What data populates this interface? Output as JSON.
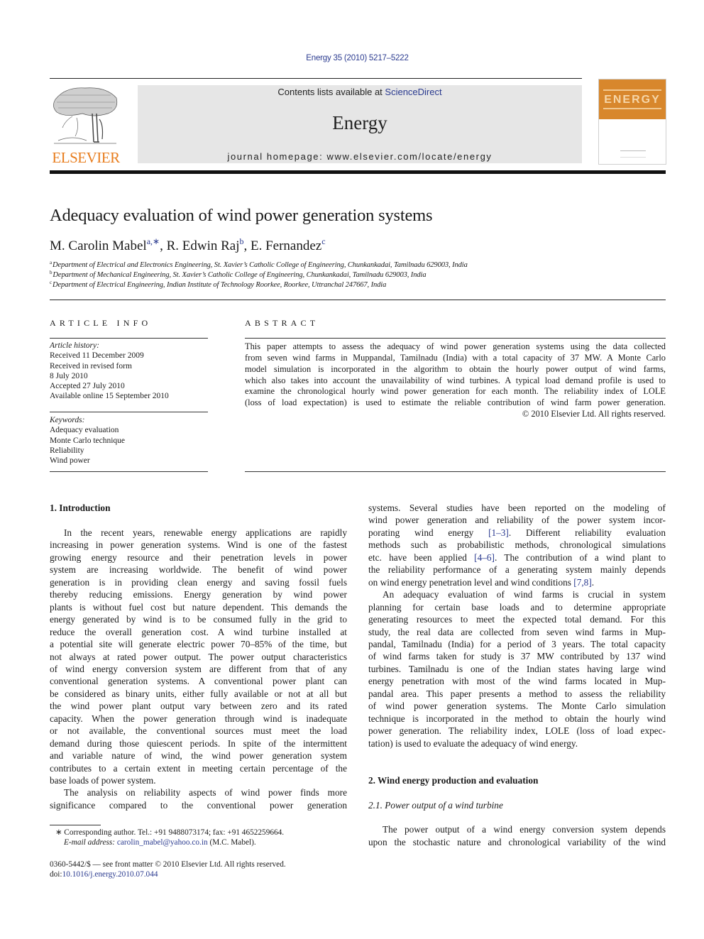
{
  "citation": "Energy 35 (2010) 5217–5222",
  "header": {
    "publisher_logo_text": "ELSEVIER",
    "contents_prefix": "Contents lists available at ",
    "contents_link": "ScienceDirect",
    "journal_name": "Energy",
    "homepage": "journal homepage: www.elsevier.com/locate/energy",
    "cover_title": "ENERGY",
    "accent_color": "#e87d1e",
    "cover_color": "#d8872c"
  },
  "title": "Adequacy evaluation of wind power generation systems",
  "authors": [
    {
      "name": "M. Carolin Mabel",
      "sup": "a,∗",
      "sep": ", "
    },
    {
      "name": "R. Edwin Raj",
      "sup": "b",
      "sep": ", "
    },
    {
      "name": "E. Fernandez",
      "sup": "c",
      "sep": ""
    }
  ],
  "affiliations": [
    {
      "mark": "a",
      "text": "Department of Electrical and Electronics Engineering, St. Xavier’s Catholic College of Engineering, Chunkankadai, Tamilnadu 629003, India"
    },
    {
      "mark": "b",
      "text": "Department of Mechanical Engineering, St. Xavier’s Catholic College of Engineering, Chunkankadai, Tamilnadu 629003, India"
    },
    {
      "mark": "c",
      "text": "Department of Electrical Engineering, Indian Institute of Technology Roorkee, Roorkee, Uttranchal 247667, India"
    }
  ],
  "article_info": {
    "heading": "ARTICLE INFO",
    "history_label": "Article history:",
    "history": [
      "Received 11 December 2009",
      "Received in revised form",
      "8 July 2010",
      "Accepted 27 July 2010",
      "Available online 15 September 2010"
    ],
    "keywords_label": "Keywords:",
    "keywords": [
      "Adequacy evaluation",
      "Monte Carlo technique",
      "Reliability",
      "Wind power"
    ]
  },
  "abstract": {
    "heading": "ABSTRACT",
    "lines": [
      "This paper attempts to assess the adequacy of wind power generation systems using the data collected",
      "from seven wind farms in Muppandal, Tamilnadu (India) with a total capacity of 37 MW. A Monte Carlo",
      "model simulation is incorporated in the algorithm to obtain the hourly power output of wind farms,",
      "which also takes into account the unavailability of wind turbines. A typical load demand profile is used to",
      "examine the chronological hourly wind power generation for each month. The reliability index of LOLE",
      "(loss of load expectation) is used to estimate the reliable contribution of wind farm power generation."
    ],
    "copyright": "© 2010 Elsevier Ltd. All rights reserved."
  },
  "body": {
    "section1_heading": "1.  Introduction",
    "left_col": [
      {
        "t": "In the recent years, renewable energy applications are rapidly",
        "i": true
      },
      {
        "t": "increasing in power generation systems. Wind is one of the fastest"
      },
      {
        "t": "growing energy resource and their penetration levels in power"
      },
      {
        "t": "system are increasing worldwide. The benefit of wind power"
      },
      {
        "t": "generation is in providing clean energy and saving fossil fuels"
      },
      {
        "t": "thereby reducing emissions. Energy generation by wind power"
      },
      {
        "t": "plants is without fuel cost but nature dependent. This demands the"
      },
      {
        "t": "energy generated by wind is to be consumed fully in the grid to"
      },
      {
        "t": "reduce the overall generation cost. A wind turbine installed at"
      },
      {
        "t": "a potential site will generate electric power 70–85% of the time, but"
      },
      {
        "t": "not always at rated power output. The power output characteristics"
      },
      {
        "t": "of wind energy conversion system are different from that of any"
      },
      {
        "t": "conventional generation systems. A conventional power plant can"
      },
      {
        "t": "be considered as binary units, either fully available or not at all but"
      },
      {
        "t": "the wind power plant output vary between zero and its rated"
      },
      {
        "t": "capacity. When the power generation through wind is inadequate"
      },
      {
        "t": "or not available, the conventional sources must meet the load"
      },
      {
        "t": "demand during those quiescent periods. In spite of the intermittent"
      },
      {
        "t": "and variable nature of wind, the wind power generation system"
      },
      {
        "t": "contributes to a certain extent in meeting certain percentage of the"
      },
      {
        "t": "base loads of power system.",
        "last": true
      },
      {
        "t": "The analysis on reliability aspects of wind power finds more",
        "i": true
      },
      {
        "t": "significance compared to the conventional power generation"
      }
    ],
    "right_col": [
      {
        "t": "systems. Several studies have been reported on the modeling of"
      },
      {
        "t": "wind power generation and reliability of the power system incor-"
      },
      {
        "t": "porating wind energy [1–3]. Different reliability evaluation"
      },
      {
        "t": "methods such as probabilistic methods, chronological simulations"
      },
      {
        "t": "etc. have been applied [4–6]. The contribution of a wind plant to"
      },
      {
        "t": "the reliability performance of a generating system mainly depends"
      },
      {
        "t": "on wind energy penetration level and wind conditions [7,8].",
        "last": true
      },
      {
        "t": "An adequacy evaluation of wind farms is crucial in system",
        "i": true
      },
      {
        "t": "planning for certain base loads and to determine appropriate"
      },
      {
        "t": "generating resources to meet the expected total demand. For this"
      },
      {
        "t": "study, the real data are collected from seven wind farms in Mup-"
      },
      {
        "t": "pandal, Tamilnadu (India) for a period of 3 years. The total capacity"
      },
      {
        "t": "of wind farms taken for study is 37 MW contributed by 137 wind"
      },
      {
        "t": "turbines. Tamilnadu is one of the Indian states having large wind"
      },
      {
        "t": "energy penetration with most of the wind farms located in Mup-"
      },
      {
        "t": "pandal area. This paper presents a method to assess the reliability"
      },
      {
        "t": "of wind power generation systems. The Monte Carlo simulation"
      },
      {
        "t": "technique is incorporated in the method to obtain the hourly wind"
      },
      {
        "t": "power generation. The reliability index, LOLE (loss of load expec-"
      },
      {
        "t": "tation) is used to evaluate the adequacy of wind energy.",
        "last": true
      }
    ],
    "section2_heading": "2.  Wind energy production and evaluation",
    "subsection21_heading": "2.1.  Power output of a wind turbine",
    "right_col_tail": [
      {
        "t": "The power output of a wind energy conversion system depends",
        "i": true
      },
      {
        "t": "upon the stochastic nature and chronological variability of the wind"
      }
    ]
  },
  "footnotes": {
    "corresponding": "∗  Corresponding author. Tel.: +91 9488073174; fax: +91 4652259664.",
    "email_label": "E-mail address: ",
    "email": "carolin_mabel@yahoo.co.in",
    "email_suffix": " (M.C. Mabel).",
    "issn": "0360-5442/$ — see front matter © 2010 Elsevier Ltd. All rights reserved.",
    "doi_label": "doi:",
    "doi": "10.1016/j.energy.2010.07.044"
  }
}
